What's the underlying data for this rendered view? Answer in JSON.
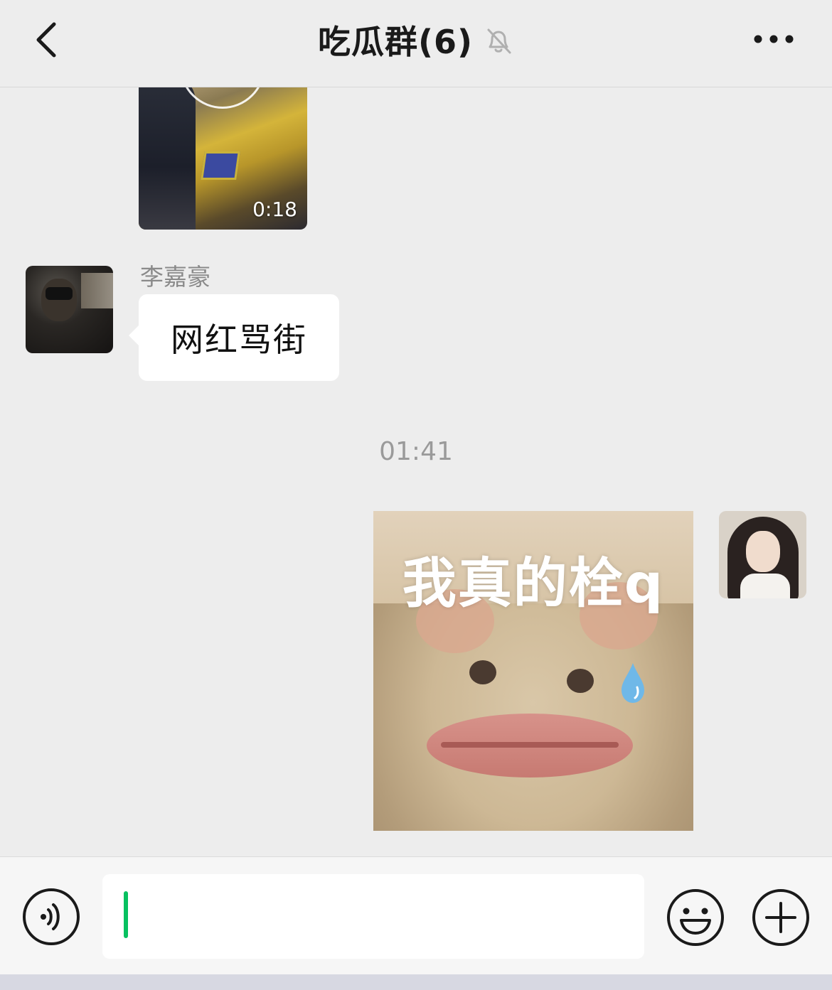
{
  "header": {
    "title": "吃瓜群(6)",
    "back_icon": "chevron-left-icon",
    "mute_icon": "bell-slash-icon",
    "more_icon": "more-dots-icon"
  },
  "messages": {
    "video": {
      "duration": "0:18"
    },
    "incoming": {
      "sender": "李嘉豪",
      "text": "网红骂街"
    },
    "timestamp": "01:41",
    "outgoing_sticker": {
      "caption": "我真的栓q"
    }
  },
  "input_bar": {
    "value": "",
    "voice_icon": "voice-icon",
    "emoji_icon": "emoji-icon",
    "plus_icon": "plus-icon",
    "caret_color": "#07c160"
  }
}
